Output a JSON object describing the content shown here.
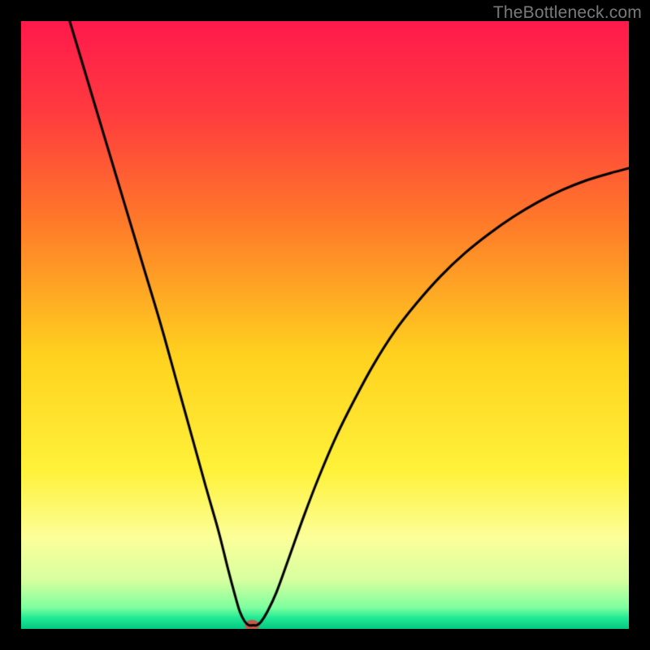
{
  "watermark": {
    "text": "TheBottleneck.com"
  },
  "chart_data": {
    "type": "line",
    "title": "",
    "xlabel": "",
    "ylabel": "",
    "xlim": [
      0,
      100
    ],
    "ylim": [
      0,
      100
    ],
    "grid": false,
    "legend": false,
    "background": {
      "type": "vertical-gradient",
      "stops": [
        {
          "pos": 0.0,
          "color": "#ff1a4c"
        },
        {
          "pos": 0.15,
          "color": "#ff3b3f"
        },
        {
          "pos": 0.33,
          "color": "#ff7a2a"
        },
        {
          "pos": 0.55,
          "color": "#ffd21f"
        },
        {
          "pos": 0.74,
          "color": "#fff23a"
        },
        {
          "pos": 0.85,
          "color": "#fcff9a"
        },
        {
          "pos": 0.92,
          "color": "#d7ffa0"
        },
        {
          "pos": 0.965,
          "color": "#7fff9e"
        },
        {
          "pos": 0.982,
          "color": "#20e994"
        },
        {
          "pos": 1.0,
          "color": "#05c884"
        }
      ]
    },
    "series": [
      {
        "name": "bottleneck-curve",
        "color": "#000000",
        "width": 3,
        "points": [
          {
            "x": 8.0,
            "y": 100.0
          },
          {
            "x": 11.0,
            "y": 90.0
          },
          {
            "x": 14.0,
            "y": 80.0
          },
          {
            "x": 17.0,
            "y": 70.0
          },
          {
            "x": 20.0,
            "y": 60.0
          },
          {
            "x": 23.0,
            "y": 50.0
          },
          {
            "x": 25.5,
            "y": 41.0
          },
          {
            "x": 28.0,
            "y": 32.0
          },
          {
            "x": 30.5,
            "y": 23.0
          },
          {
            "x": 32.5,
            "y": 16.0
          },
          {
            "x": 34.0,
            "y": 10.0
          },
          {
            "x": 35.2,
            "y": 5.5
          },
          {
            "x": 36.0,
            "y": 2.8
          },
          {
            "x": 36.8,
            "y": 1.2
          },
          {
            "x": 37.5,
            "y": 0.6
          },
          {
            "x": 38.2,
            "y": 0.6
          },
          {
            "x": 38.8,
            "y": 0.6
          },
          {
            "x": 39.5,
            "y": 1.2
          },
          {
            "x": 40.5,
            "y": 2.8
          },
          {
            "x": 42.0,
            "y": 6.0
          },
          {
            "x": 44.0,
            "y": 11.5
          },
          {
            "x": 46.5,
            "y": 18.5
          },
          {
            "x": 49.0,
            "y": 25.0
          },
          {
            "x": 52.0,
            "y": 32.0
          },
          {
            "x": 55.0,
            "y": 38.0
          },
          {
            "x": 58.0,
            "y": 43.5
          },
          {
            "x": 61.5,
            "y": 49.0
          },
          {
            "x": 65.0,
            "y": 53.5
          },
          {
            "x": 69.0,
            "y": 58.0
          },
          {
            "x": 73.0,
            "y": 61.8
          },
          {
            "x": 77.0,
            "y": 65.0
          },
          {
            "x": 81.0,
            "y": 67.8
          },
          {
            "x": 85.0,
            "y": 70.2
          },
          {
            "x": 89.0,
            "y": 72.2
          },
          {
            "x": 93.0,
            "y": 73.8
          },
          {
            "x": 97.0,
            "y": 75.0
          },
          {
            "x": 100.0,
            "y": 75.8
          }
        ]
      }
    ],
    "marker": {
      "name": "bottleneck-point",
      "x": 38.0,
      "y": 0.6,
      "rx": 1.2,
      "ry": 0.9,
      "fill": "#c55a4a"
    }
  }
}
